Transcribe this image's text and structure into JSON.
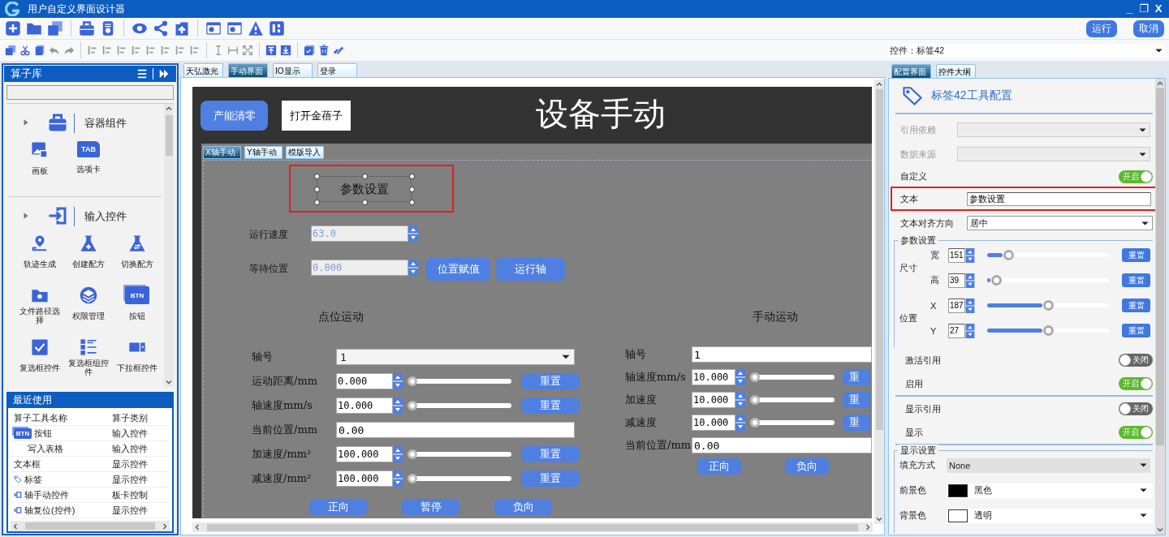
{
  "window": {
    "title": "用户自定义界面设计器",
    "controls": [
      "_",
      "❐",
      "X"
    ]
  },
  "toolbar": {
    "buttons": [
      "运行",
      "取消"
    ]
  },
  "control_selector": {
    "value": "控件：标签42"
  },
  "operator_library": {
    "title": "算子库",
    "groups": [
      {
        "label": "容器组件",
        "expanded": false,
        "kind": "container",
        "items": [
          {
            "label": "画板",
            "kind": "image"
          },
          {
            "label": "选项卡",
            "kind": "tab",
            "icon_text": "TAB"
          }
        ]
      },
      {
        "label": "输入控件",
        "expanded": false,
        "kind": "input",
        "items": [
          {
            "label": "轨迹生成",
            "kind": "pin"
          },
          {
            "label": "创建配方",
            "kind": "flask"
          },
          {
            "label": "切换配方",
            "kind": "flaskswap"
          },
          {
            "label": "文件路径选择",
            "kind": "folderpin"
          },
          {
            "label": "权限管理",
            "kind": "layers"
          },
          {
            "label": "按钮",
            "kind": "btn",
            "icon_text": "BTN"
          },
          {
            "label": "复选框控件",
            "kind": "check"
          },
          {
            "label": "复选框组控件",
            "kind": "checklist"
          },
          {
            "label": "下拉框控件",
            "kind": "dropdown"
          }
        ]
      }
    ]
  },
  "recent": {
    "title": "最近使用",
    "columns": [
      "算子工具名称",
      "算子类别"
    ],
    "rows": [
      {
        "name": "按钮",
        "category": "输入控件",
        "kind": "btn",
        "icon_text": "BTN"
      },
      {
        "name": "写入表格",
        "category": "输入控件",
        "kind": "none"
      },
      {
        "name": "文本框",
        "category": "显示控件",
        "kind": "text"
      },
      {
        "name": "标签",
        "category": "显示控件",
        "kind": "tag"
      },
      {
        "name": "轴手动控件",
        "category": "板卡控制",
        "kind": "axis"
      },
      {
        "name": "轴复位(控件)",
        "category": "显示控件",
        "kind": "axis"
      }
    ]
  },
  "document_tabs": [
    {
      "label": "天弘激光",
      "selected": false
    },
    {
      "label": "手动界面",
      "selected": true
    },
    {
      "label": "IO显示",
      "selected": false
    },
    {
      "label": "登录",
      "selected": false
    }
  ],
  "design_canvas": {
    "header_buttons": [
      {
        "label": "产能清零",
        "kind": "primary"
      },
      {
        "label": "打开金蓓子",
        "kind": "plain"
      }
    ],
    "title": "设备手动",
    "tabs": [
      {
        "label": "X轴手动",
        "selected": true
      },
      {
        "label": "Y轴手动",
        "selected": false
      },
      {
        "label": "模版导入",
        "selected": false
      }
    ],
    "selected_label": {
      "text": "参数设置",
      "selected": true,
      "highlighted": true
    },
    "speed": {
      "label": "运行速度",
      "value": "63.0"
    },
    "wait": {
      "label": "等待位置",
      "value": "0.000",
      "buttons": [
        "位置赋值",
        "运行轴"
      ]
    },
    "point_motion": {
      "title": "点位运动",
      "rows": [
        {
          "kind": "select",
          "label": "轴号",
          "value": "1"
        },
        {
          "kind": "spin",
          "label": "运动距离/mm",
          "value": "0.000",
          "level": 0,
          "button": "重置"
        },
        {
          "kind": "spin",
          "label": "轴速度mm/s",
          "value": "10.000",
          "level": 0,
          "button": "重置"
        },
        {
          "kind": "text",
          "label": "当前位置/mm",
          "value": "0.00"
        },
        {
          "kind": "spin",
          "label": "加速度/mm²",
          "value": "100.000",
          "level": 0,
          "button": "重置"
        },
        {
          "kind": "spin",
          "label": "减速度/mm²",
          "value": "100.000",
          "level": 0,
          "button": "重置"
        }
      ],
      "buttons": [
        "正向",
        "暂停",
        "负向"
      ]
    },
    "manual_motion": {
      "title": "手动运动",
      "rows": [
        {
          "kind": "text",
          "label": "轴号",
          "value": "1"
        },
        {
          "kind": "spin",
          "label": "轴速度mm/s",
          "value": "10.000",
          "level": 0,
          "button": "重"
        },
        {
          "kind": "spin",
          "label": "加速度",
          "value": "10.000",
          "level": 0,
          "button": "重"
        },
        {
          "kind": "spin",
          "label": "减速度",
          "value": "10.000",
          "level": 0,
          "button": "重"
        },
        {
          "kind": "text",
          "label": "当前位置/mm",
          "value": "0.00"
        }
      ],
      "buttons": [
        "正向",
        "负向"
      ]
    }
  },
  "properties": {
    "tabs": [
      {
        "label": "配置界面",
        "selected": true
      },
      {
        "label": "控件大纲",
        "selected": false
      }
    ],
    "title": "标签42工具配置",
    "rows": [
      {
        "kind": "select",
        "label": "引用依赖",
        "disabled": true
      },
      {
        "kind": "select",
        "label": "数据来源",
        "disabled": true
      },
      {
        "kind": "toggle",
        "label": "自定义",
        "on": true,
        "state": "开启"
      },
      {
        "kind": "text",
        "label": "文本",
        "value": "参数设置",
        "highlighted": true
      },
      {
        "kind": "select",
        "label": "文本对齐方向",
        "value": "居中",
        "disabled": false
      }
    ],
    "params": {
      "title": "参数设置",
      "groups": [
        {
          "label": "尺寸",
          "rows": [
            {
              "label": "宽",
              "value": "151",
              "level": 0.17,
              "button": "重置"
            },
            {
              "label": "高",
              "value": "39",
              "level": 0.07,
              "button": "重置"
            }
          ]
        },
        {
          "label": "位置",
          "rows": [
            {
              "label": "X",
              "value": "187",
              "level": 0.5,
              "button": "重置"
            },
            {
              "label": "Y",
              "value": "27",
              "level": 0.5,
              "button": "重置"
            }
          ]
        }
      ]
    },
    "switch_groups": [
      [
        {
          "label": "激活引用",
          "on": false,
          "state": "关闭"
        },
        {
          "label": "启用",
          "on": true,
          "state": "开启"
        }
      ],
      [
        {
          "label": "显示引用",
          "on": false,
          "state": "关闭"
        },
        {
          "label": "显示",
          "on": true,
          "state": "开启"
        }
      ]
    ],
    "display": {
      "title": "显示设置",
      "rows": [
        {
          "kind": "select",
          "label": "填充方式",
          "value": "None"
        },
        {
          "kind": "color",
          "label": "前景色",
          "value": "黑色",
          "color": "#000000"
        },
        {
          "kind": "color",
          "label": "背景色",
          "value": "透明",
          "color": "#ffffff"
        }
      ]
    }
  }
}
